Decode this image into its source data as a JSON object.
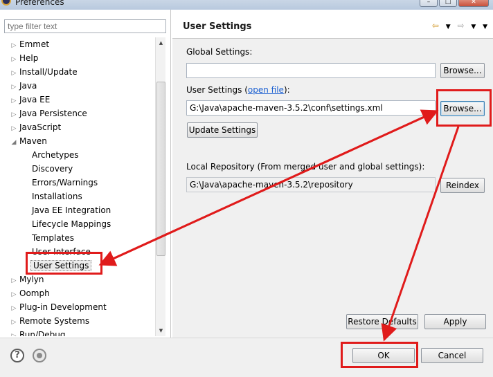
{
  "window": {
    "title": "Preferences",
    "controls": [
      "–",
      "□",
      "✕"
    ]
  },
  "filter": {
    "placeholder": "type filter text"
  },
  "tree": [
    {
      "label": "Emmet",
      "level": 0,
      "expander": "▷"
    },
    {
      "label": "Help",
      "level": 0,
      "expander": "▷"
    },
    {
      "label": "Install/Update",
      "level": 0,
      "expander": "▷"
    },
    {
      "label": "Java",
      "level": 0,
      "expander": "▷"
    },
    {
      "label": "Java EE",
      "level": 0,
      "expander": "▷"
    },
    {
      "label": "Java Persistence",
      "level": 0,
      "expander": "▷"
    },
    {
      "label": "JavaScript",
      "level": 0,
      "expander": "▷"
    },
    {
      "label": "Maven",
      "level": 0,
      "expander": "◢"
    },
    {
      "label": "Archetypes",
      "level": 1,
      "expander": ""
    },
    {
      "label": "Discovery",
      "level": 1,
      "expander": ""
    },
    {
      "label": "Errors/Warnings",
      "level": 1,
      "expander": ""
    },
    {
      "label": "Installations",
      "level": 1,
      "expander": ""
    },
    {
      "label": "Java EE Integration",
      "level": 1,
      "expander": ""
    },
    {
      "label": "Lifecycle Mappings",
      "level": 1,
      "expander": ""
    },
    {
      "label": "Templates",
      "level": 1,
      "expander": ""
    },
    {
      "label": "User Interface",
      "level": 1,
      "expander": ""
    },
    {
      "label": "User Settings",
      "level": 1,
      "expander": "",
      "selected": true
    },
    {
      "label": "Mylyn",
      "level": 0,
      "expander": "▷"
    },
    {
      "label": "Oomph",
      "level": 0,
      "expander": "▷"
    },
    {
      "label": "Plug-in Development",
      "level": 0,
      "expander": "▷"
    },
    {
      "label": "Remote Systems",
      "level": 0,
      "expander": "▷"
    },
    {
      "label": "Run/Debug",
      "level": 0,
      "expander": "▷"
    }
  ],
  "page": {
    "title": "User Settings",
    "nav_icons": [
      "back-arrow-icon",
      "dropdown-icon",
      "forward-arrow-icon",
      "dropdown-icon",
      "menu-icon"
    ],
    "global_settings_label": "Global Settings:",
    "global_settings_value": "",
    "browse_label": "Browse...",
    "user_settings_label": "User Settings (",
    "open_file_link": "open file",
    "user_settings_label_end": "):",
    "user_settings_value": "G:\\Java\\apache-maven-3.5.2\\conf\\settings.xml",
    "update_settings_label": "Update Settings",
    "local_repo_label": "Local Repository (From merged user and global settings):",
    "local_repo_value": "G:\\Java\\apache-maven-3.5.2\\repository",
    "reindex_label": "Reindex",
    "restore_defaults_label": "Restore Defaults",
    "apply_label": "Apply"
  },
  "footer": {
    "ok_label": "OK",
    "cancel_label": "Cancel"
  },
  "colors": {
    "annotation": "#e01b1b",
    "link": "#1a5fd1"
  }
}
